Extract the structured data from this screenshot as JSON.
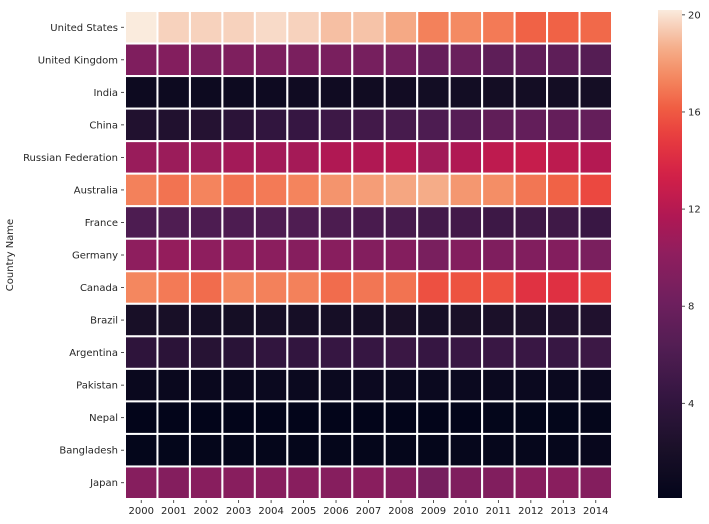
{
  "chart_data": {
    "type": "heatmap",
    "title": "",
    "xlabel": "",
    "ylabel": "Country Name",
    "colormap": "rocket",
    "x": [
      "2000",
      "2001",
      "2002",
      "2003",
      "2004",
      "2005",
      "2006",
      "2007",
      "2008",
      "2009",
      "2010",
      "2011",
      "2012",
      "2013",
      "2014"
    ],
    "y": [
      "United States",
      "United Kingdom",
      "India",
      "China",
      "Russian Federation",
      "Australia",
      "France",
      "Germany",
      "Canada",
      "Brazil",
      "Argentina",
      "Pakistan",
      "Nepal",
      "Bangladesh",
      "Japan"
    ],
    "values": [
      [
        20.2,
        19.6,
        19.6,
        19.6,
        19.8,
        19.6,
        19.1,
        19.2,
        18.5,
        17.2,
        17.5,
        17.0,
        16.3,
        16.3,
        16.5
      ],
      [
        9.2,
        9.4,
        9.0,
        9.1,
        9.0,
        8.9,
        8.8,
        8.6,
        8.4,
        7.6,
        7.8,
        7.1,
        7.3,
        7.1,
        6.5
      ],
      [
        1.0,
        1.0,
        1.0,
        1.0,
        1.1,
        1.2,
        1.2,
        1.3,
        1.4,
        1.5,
        1.5,
        1.6,
        1.6,
        1.6,
        1.7
      ],
      [
        2.7,
        2.7,
        3.0,
        3.5,
        4.0,
        4.4,
        4.9,
        5.2,
        5.6,
        6.0,
        6.6,
        7.2,
        7.4,
        7.5,
        7.5
      ],
      [
        10.6,
        10.7,
        10.7,
        11.1,
        11.1,
        11.2,
        11.7,
        11.7,
        12.0,
        11.0,
        11.7,
        12.4,
        12.8,
        12.3,
        11.9
      ],
      [
        17.2,
        16.8,
        17.3,
        16.8,
        17.0,
        17.3,
        17.8,
        18.1,
        18.4,
        18.6,
        17.9,
        17.6,
        16.9,
        16.3,
        15.4
      ],
      [
        6.0,
        6.1,
        6.0,
        6.0,
        6.1,
        6.1,
        5.9,
        5.7,
        5.6,
        5.3,
        5.2,
        4.9,
        5.0,
        5.0,
        4.6
      ],
      [
        10.1,
        10.4,
        10.1,
        10.1,
        9.9,
        9.6,
        9.7,
        9.4,
        9.5,
        8.8,
        9.4,
        9.2,
        9.3,
        9.4,
        8.9
      ],
      [
        17.4,
        17.0,
        16.6,
        17.4,
        17.2,
        17.2,
        16.6,
        16.9,
        16.8,
        15.7,
        15.8,
        15.7,
        14.4,
        14.3,
        15.1
      ],
      [
        1.9,
        1.9,
        1.8,
        1.7,
        1.8,
        1.8,
        1.8,
        1.8,
        2.0,
        1.8,
        2.1,
        2.2,
        2.4,
        2.6,
        2.6
      ],
      [
        3.8,
        3.5,
        3.2,
        3.4,
        4.0,
        4.1,
        4.4,
        4.4,
        4.7,
        4.4,
        4.6,
        4.6,
        4.6,
        4.5,
        4.8
      ],
      [
        0.7,
        0.7,
        0.7,
        0.7,
        0.8,
        0.8,
        0.8,
        0.9,
        0.8,
        0.8,
        0.8,
        0.8,
        0.8,
        0.8,
        0.9
      ],
      [
        0.1,
        0.1,
        0.1,
        0.1,
        0.1,
        0.1,
        0.1,
        0.1,
        0.1,
        0.1,
        0.1,
        0.2,
        0.2,
        0.2,
        0.3
      ],
      [
        0.2,
        0.2,
        0.3,
        0.3,
        0.3,
        0.3,
        0.3,
        0.3,
        0.3,
        0.3,
        0.4,
        0.4,
        0.4,
        0.4,
        0.5
      ],
      [
        9.6,
        9.5,
        9.7,
        9.7,
        9.7,
        9.7,
        9.6,
        9.8,
        9.4,
        8.6,
        9.2,
        9.3,
        9.7,
        9.8,
        9.5
      ]
    ],
    "vmin": 0.1,
    "vmax": 20.2,
    "colorbar_ticks": [
      4,
      8,
      12,
      16,
      20
    ],
    "colorbar_placement": "right",
    "grid": false
  }
}
